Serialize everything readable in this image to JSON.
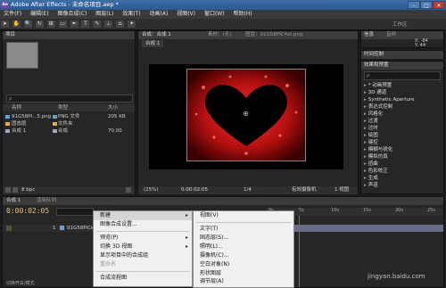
{
  "window": {
    "title": "Adobe After Effects - 未命名项目.aep *",
    "icon_text": "Ae",
    "min": "–",
    "max": "□",
    "close": "✕"
  },
  "menubar": [
    "文件(F)",
    "编辑(E)",
    "图像合成(C)",
    "图层(L)",
    "效果(T)",
    "动画(A)",
    "视图(V)",
    "窗口(W)",
    "帮助(H)"
  ],
  "toolbar": {
    "icons": [
      "➤",
      "✋",
      "🔍",
      "↻",
      "⊞",
      "▭",
      "✒",
      "T",
      "✎",
      "⊥",
      "⌂",
      "✦"
    ],
    "workspace_label": "工作区"
  },
  "project": {
    "tab": "项目",
    "search_placeholder": "ρ",
    "header": {
      "name": "名称",
      "type": "类型",
      "size": "大小"
    },
    "items": [
      {
        "name": "91G58PI...5.png",
        "type": "PNG 文件",
        "size": "205 KB"
      },
      {
        "name": "固态层",
        "type": "文件夹",
        "size": ""
      },
      {
        "name": "合成 1",
        "type": "合成",
        "size": "70.00"
      }
    ],
    "bpc": "8 bpc"
  },
  "viewer": {
    "tab1": "合成：合成 1",
    "tab2": "素材：(无)",
    "tab3": "图层：91G58PIC4zt.png",
    "comp_label": "合成 1",
    "zoom": "(25%)",
    "timecode": "0:00:02:05",
    "res": "1/4",
    "camera": "有效摄像机",
    "views": "1 视图"
  },
  "info": {
    "tab1": "信息",
    "tab2": "音频",
    "rgb": "R:\nG:\nB:\nA: 0",
    "xy": "X: -84\nY: 44"
  },
  "preview": {
    "tab": "时间控制"
  },
  "effects": {
    "tab": "效果和预置",
    "search_placeholder": "ρ",
    "list": [
      "* 动画预置",
      "3D 通道",
      "Synthetic Aperture",
      "表达式控制",
      "风格化",
      "过渡",
      "过时",
      "绘图",
      "键控",
      "模糊与锐化",
      "模拟仿真",
      "扭曲",
      "色彩校正",
      "生成",
      "声道"
    ]
  },
  "timeline": {
    "tab1": "合成 1",
    "tab2": "渲染队列",
    "timecode": "0:00:02:05",
    "layer_num": "1",
    "layer_name": "91G58PICe...",
    "ruler": [
      "0s",
      "5s",
      "10s",
      "15s",
      "20s",
      "25s"
    ],
    "bottom_text": "切换开关/模式"
  },
  "context_menu": {
    "items": [
      {
        "label": "新建",
        "sub": true,
        "disabled": false,
        "hl": true
      },
      {
        "label": "图像合成设置...",
        "sub": false,
        "disabled": false,
        "hl": false
      },
      {
        "label": "预览(P)",
        "sub": true,
        "disabled": false,
        "hl": false
      },
      {
        "label": "切换 3D 视图",
        "sub": true,
        "disabled": false,
        "hl": false
      },
      {
        "label": "显示项目中的合成组",
        "sub": false,
        "disabled": false,
        "hl": false
      },
      {
        "label": "重命名",
        "sub": false,
        "disabled": true,
        "hl": false
      },
      {
        "label": "合成流程图",
        "sub": false,
        "disabled": false,
        "hl": false
      }
    ]
  },
  "submenu": {
    "items": [
      "视图(V)",
      "文字(T)",
      "固态层(S)...",
      "照明(L)...",
      "摄像机(C)...",
      "空白对象(N)",
      "形状图层",
      "调节层(A)"
    ]
  },
  "watermark": "jingyan.baidu.com",
  "colors": {
    "accent": "#2b5a92",
    "heart_red": "#c01515"
  }
}
